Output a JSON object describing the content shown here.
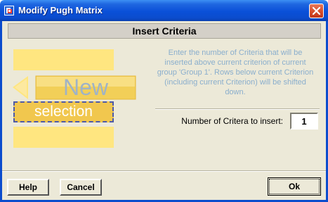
{
  "window": {
    "title": "Modify Pugh Matrix"
  },
  "header": {
    "title": "Insert Criteria"
  },
  "illustration": {
    "new_label": "New",
    "selection_label": "selection"
  },
  "info": {
    "text": "Enter the number of Criteria that will be inserted above current criterion of current group 'Group 1'. Rows below current Criterion (including current Criterion) will be shifted down."
  },
  "form": {
    "count_label": "Number of Critera to insert:",
    "count_value": "1"
  },
  "buttons": {
    "help": "Help",
    "cancel": "Cancel",
    "ok": "Ok"
  },
  "icons": {
    "app": "pugh-matrix-app-icon",
    "close": "close-icon",
    "arrow": "left-arrow-icon"
  },
  "colors": {
    "titlebar": "#0b4ccd",
    "info_text": "#8aaecd",
    "yellow_block": "#ffe680",
    "selection_border": "#4e5aa8",
    "close_button": "#d9502d"
  }
}
